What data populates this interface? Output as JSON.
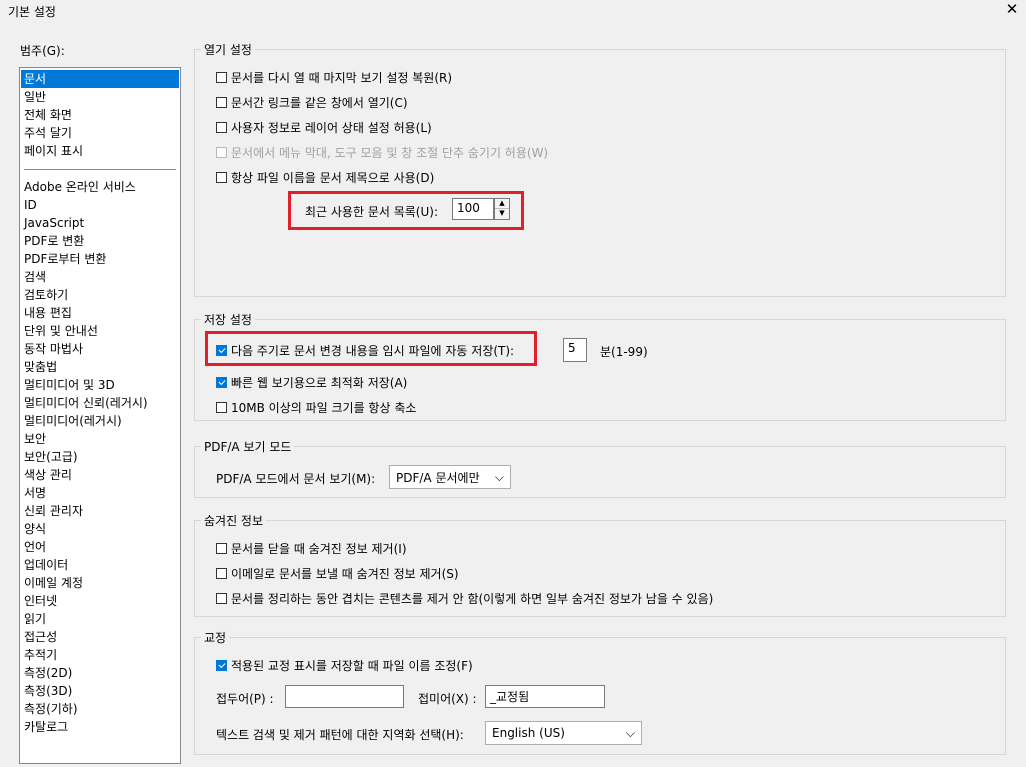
{
  "window": {
    "title": "기본 설정",
    "close": "✕"
  },
  "categories": {
    "label": "범주(G):",
    "items_top": [
      "문서",
      "일반",
      "전체 화면",
      "주석 달기",
      "페이지 표시"
    ],
    "items_bottom": [
      "Adobe 온라인 서비스",
      "ID",
      "JavaScript",
      "PDF로 변환",
      "PDF로부터 변환",
      "검색",
      "검토하기",
      "내용 편집",
      "단위 및 안내선",
      "동작 마법사",
      "맞춤법",
      "멀티미디어 및 3D",
      "멀티미디어 신뢰(레거시)",
      "멀티미디어(레거시)",
      "보안",
      "보안(고급)",
      "색상 관리",
      "서명",
      "신뢰 관리자",
      "양식",
      "언어",
      "업데이터",
      "이메일 계정",
      "인터넷",
      "읽기",
      "접근성",
      "추적기",
      "측정(2D)",
      "측정(3D)",
      "측정(기하)",
      "카탈로그"
    ],
    "selected": "문서"
  },
  "open_settings": {
    "title": "열기 설정",
    "opt1": "문서를 다시 열 때 마지막 보기 설정 복원(R)",
    "opt2": "문서간 링크를 같은 창에서 열기(C)",
    "opt3": "사용자 정보로 레이어 상태 설정 허용(L)",
    "opt4": "문서에서 메뉴 막대, 도구 모음 및 창 조절 단추 숨기기 허용(W)",
    "opt5": "항상 파일 이름을 문서 제목으로 사용(D)",
    "recent_label": "최근 사용한 문서 목록(U):",
    "recent_value": "100"
  },
  "save_settings": {
    "title": "저장 설정",
    "opt1": "다음 주기로 문서 변경 내용을 임시 파일에 자동 저장(T):",
    "interval_value": "5",
    "interval_unit": "분(1-99)",
    "opt2": "빠른 웹 보기용으로 최적화 저장(A)",
    "opt3": "10MB 이상의 파일 크기를 항상 축소"
  },
  "pdfa": {
    "title": "PDF/A 보기 모드",
    "label": "PDF/A 모드에서 문서 보기(M):",
    "value": "PDF/A 문서에만"
  },
  "hidden_info": {
    "title": "숨겨진 정보",
    "opt1": "문서를 닫을 때 숨겨진 정보 제거(I)",
    "opt2": "이메일로 문서를 보낼 때 숨겨진 정보 제거(S)",
    "opt3": "문서를 정리하는 동안 겹치는 콘텐츠를 제거 안 함(이렇게 하면 일부 숨겨진 정보가 남을 수 있음)"
  },
  "proofing": {
    "title": "교정",
    "opt1": "적용된 교정 표시를 저장할 때 파일 이름 조정(F)",
    "prefix_label": "접두어(P) :",
    "prefix_value": "",
    "suffix_label": "접미어(X) :",
    "suffix_value": "_교정됨",
    "locale_label": "텍스트 검색 및 제거 패턴에 대한 지역화 선택(H):",
    "locale_value": "English (US)"
  }
}
